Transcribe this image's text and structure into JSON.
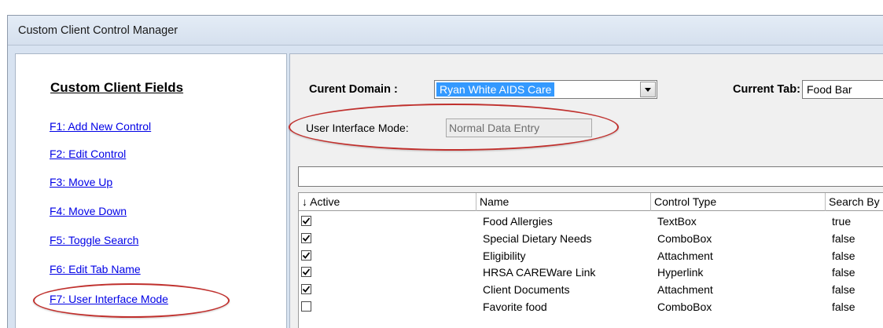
{
  "window": {
    "title": "Custom Client Control Manager"
  },
  "sidebar": {
    "title": "Custom Client Fields",
    "items": [
      {
        "label": "F1: Add New Control"
      },
      {
        "label": "F2: Edit Control"
      },
      {
        "label": "F3: Move Up"
      },
      {
        "label": "F4: Move Down"
      },
      {
        "label": "F5: Toggle Search"
      },
      {
        "label": "F6: Edit Tab Name"
      },
      {
        "label": "F7: User Interface Mode"
      }
    ]
  },
  "header": {
    "domain_label": "Curent Domain :",
    "domain_value": "Ryan White AIDS Care",
    "tab_label": "Current Tab:",
    "tab_value": "Food Bar",
    "ui_mode_label": "User Interface Mode:",
    "ui_mode_value": "Normal Data Entry"
  },
  "filter": {
    "value": ""
  },
  "grid": {
    "sort_indicator": "↓",
    "columns": [
      "Active",
      "Name",
      "Control Type",
      "Search By"
    ],
    "rows": [
      {
        "active": true,
        "name": "Food Allergies",
        "type": "TextBox",
        "search": "true"
      },
      {
        "active": true,
        "name": "Special Dietary Needs",
        "type": "ComboBox",
        "search": "false"
      },
      {
        "active": true,
        "name": "Eligibility",
        "type": "Attachment",
        "search": "false"
      },
      {
        "active": true,
        "name": "HRSA CAREWare Link",
        "type": "Hyperlink",
        "search": "false"
      },
      {
        "active": true,
        "name": "Client Documents",
        "type": "Attachment",
        "search": "false"
      },
      {
        "active": false,
        "name": "Favorite food",
        "type": "ComboBox",
        "search": "false"
      }
    ]
  },
  "colors": {
    "highlight": "#3399ff",
    "link": "#0000e6",
    "annotation": "#c0302d"
  }
}
